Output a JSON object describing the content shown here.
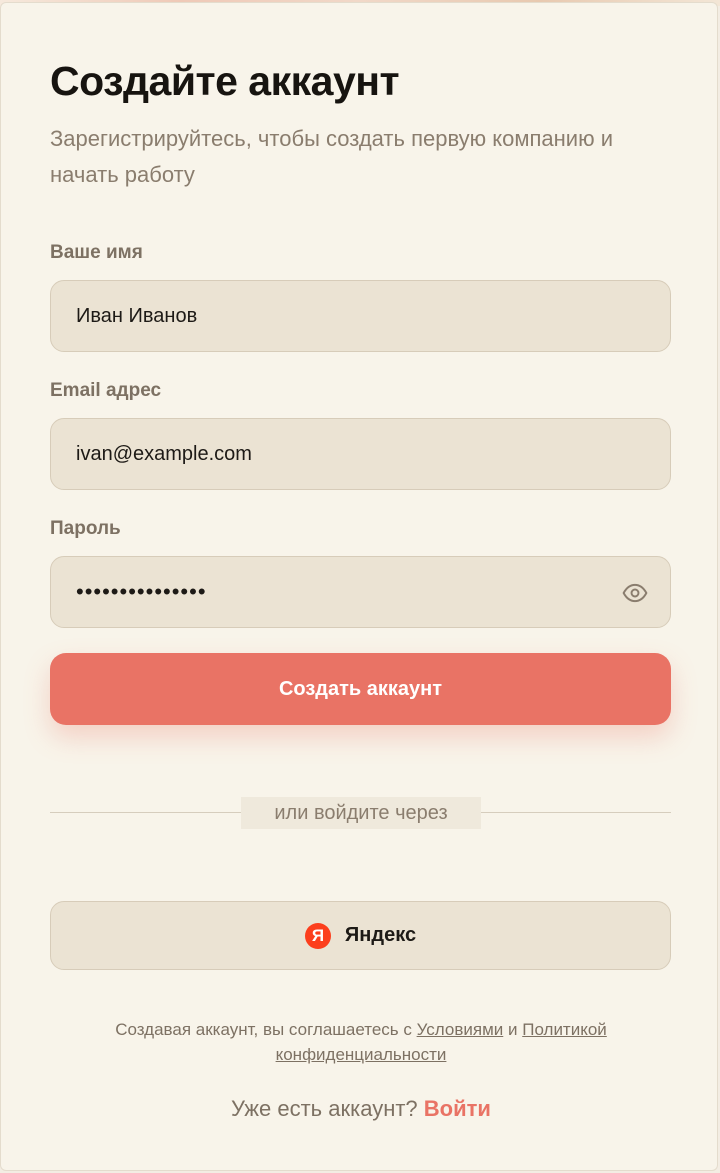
{
  "colors": {
    "accent": "#e97365",
    "card_bg": "#f8f4ea",
    "field_bg": "#ebe3d3",
    "yandex_red": "#fc3f1d"
  },
  "header": {
    "title": "Создайте аккаунт",
    "subtitle": "Зарегистрируйтесь, чтобы создать первую компанию и начать работу"
  },
  "form": {
    "name": {
      "label": "Ваше имя",
      "value": "Иван Иванов"
    },
    "email": {
      "label": "Email адрес",
      "value": "ivan@example.com"
    },
    "password": {
      "label": "Пароль",
      "value": "•••••••••••••••",
      "toggle_icon": "eye-icon"
    },
    "submit_label": "Создать аккаунт"
  },
  "divider": {
    "text": "или войдите через"
  },
  "social": {
    "yandex": {
      "logo_letter": "Я",
      "label": "Яндекс",
      "icon": "yandex-logo-icon"
    }
  },
  "terms": {
    "prefix": "Создавая аккаунт, вы соглашаетесь с ",
    "terms_link": "Условиями",
    "conjunction": " и ",
    "privacy_link": "Политикой конфиденциальности"
  },
  "login": {
    "prompt": "Уже есть аккаунт? ",
    "link": "Войти"
  }
}
